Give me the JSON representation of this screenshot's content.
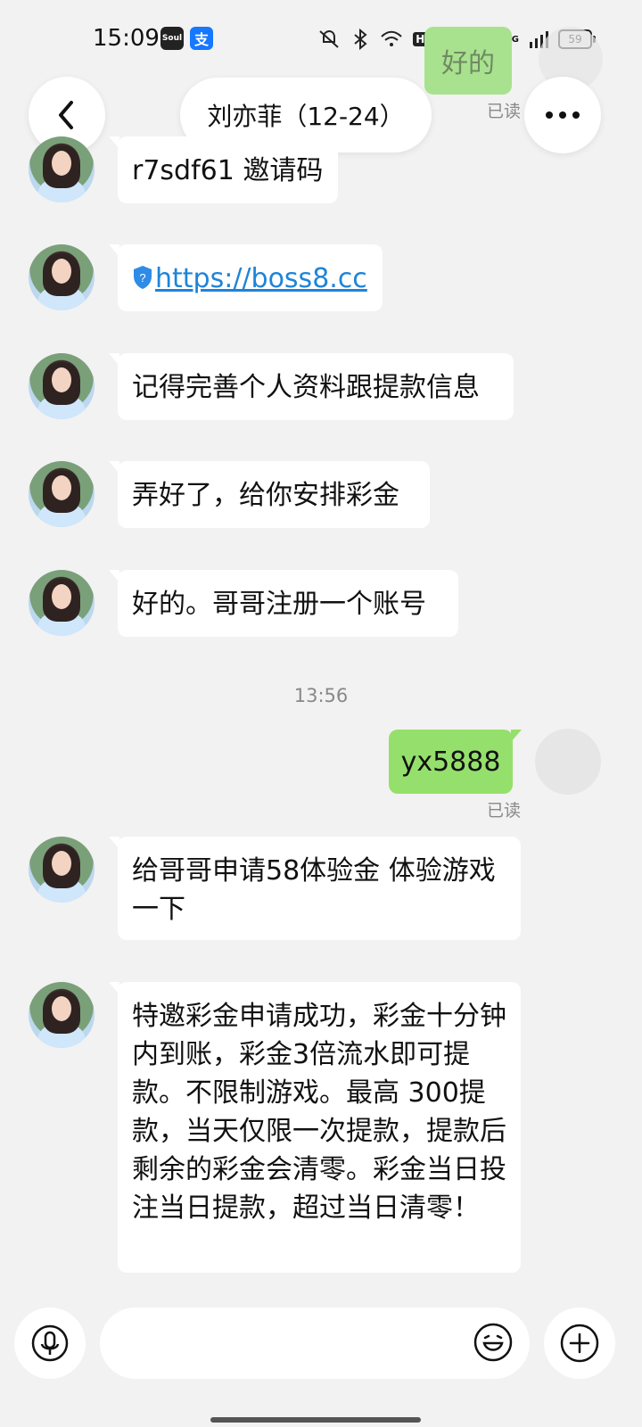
{
  "status": {
    "time": "15:09",
    "apps": [
      "Soul",
      "支"
    ],
    "network": "4G",
    "battery": "59",
    "hd": "HD2"
  },
  "header": {
    "title": "刘亦菲（12-24）",
    "top_message": "好的",
    "top_read": "已读"
  },
  "messages": [
    {
      "text": "r7sdf61 邀请码"
    },
    {
      "text": "https://boss8.cc"
    },
    {
      "text": "记得完善个人资料跟提款信息"
    },
    {
      "text": "弄好了，给你安排彩金"
    },
    {
      "text": "好的。哥哥注册一个账号"
    }
  ],
  "timestamp": "13:56",
  "outgoing": {
    "text": "yx5888",
    "read": "已读"
  },
  "later_messages": [
    {
      "text": "给哥哥申请58体验金  体验游戏一下"
    },
    {
      "text": "特邀彩金申请成功，彩金十分钟内到账，彩金3倍流水即可提款。不限制游戏。最高 300提款，当天仅限一次提款，提款后剩余的彩金会清零。彩金当日投注当日提款，超过当日清零！"
    }
  ],
  "colors": {
    "background": "#f2f2f2",
    "outgoing_bubble": "#95e06c",
    "link": "#1e84d8"
  }
}
